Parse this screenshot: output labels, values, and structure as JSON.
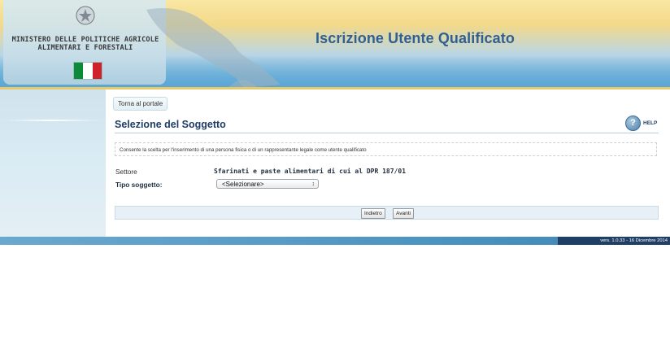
{
  "header": {
    "ministry_line1": "MINISTERO DELLE POLITICHE AGRICOLE",
    "ministry_line2": "ALIMENTARI E FORESTALI",
    "app_title": "Iscrizione Utente Qualificato",
    "flag_colors": [
      "#0b8a3a",
      "#ffffff",
      "#d0212a"
    ]
  },
  "nav": {
    "portal_button": "Torna al portale"
  },
  "main": {
    "title": "Selezione del Soggetto",
    "help_label": "HELP",
    "help_icon_text": "?",
    "description": "Consente la scelta per l'inserimento di una persona fisica o di un rappresentante legale come utente qualificato",
    "settore_label": "Settore",
    "settore_value": "Sfarinati e paste alimentari di cui al DPR 187/01",
    "tipo_label": "Tipo soggetto:",
    "tipo_select_value": "<Selezionare>",
    "back_button": "Indietro",
    "next_button": "Avanti"
  },
  "footer": {
    "version": "vers. 1.0.33 - 16 Dicembre 2014"
  },
  "colors": {
    "accent": "#2f5f93",
    "title": "#1f3d66",
    "footer_dark": "#1f3f66"
  }
}
